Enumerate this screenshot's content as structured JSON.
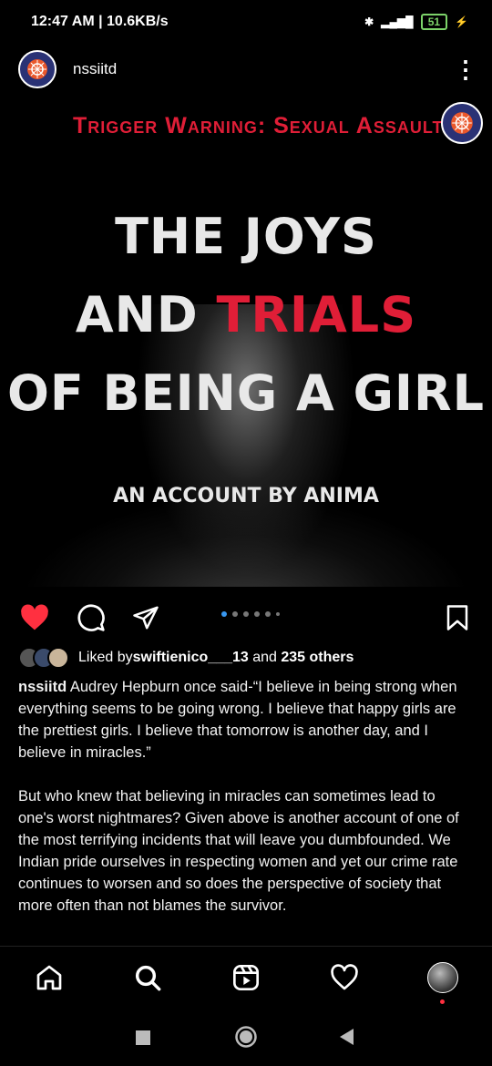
{
  "status_bar": {
    "time": "12:47 AM | 10.6KB/s",
    "battery": "51"
  },
  "post_header": {
    "username": "nssiitd"
  },
  "post_image": {
    "trigger_warning": "Trigger Warning: Sexual Assault",
    "line1": "THE JOYS",
    "line2_a": "AND ",
    "line2_b": "TRIALS",
    "line3": "OF BEING A GIRL",
    "subtitle": "AN ACCOUNT BY ANIMA"
  },
  "likes": {
    "prefix": "Liked by ",
    "user": "swiftienico___13",
    "middle": " and ",
    "others": "235 others"
  },
  "caption": {
    "username": "nssiitd",
    "para1": " Audrey Hepburn once said-“I believe in being strong when everything seems to be going wrong. I believe that happy girls are the prettiest girls. I believe that tomorrow is another day, and I believe in miracles.”",
    "para2": "But who knew that believing in miracles can sometimes lead to one's worst nightmares? Given above is another account of one of the most terrifying incidents that will leave you dumbfounded. We Indian pride ourselves in respecting women and yet our crime rate continues to worsen and so does the perspective of society that more often than not blames the survivor."
  },
  "colors": {
    "accent_red": "#e01e37",
    "like_red": "#ff3040",
    "carousel_blue": "#3897f0"
  },
  "icons": [
    "heart-icon",
    "comment-icon",
    "share-icon",
    "bookmark-icon",
    "home-icon",
    "search-icon",
    "reels-icon",
    "activity-icon"
  ]
}
